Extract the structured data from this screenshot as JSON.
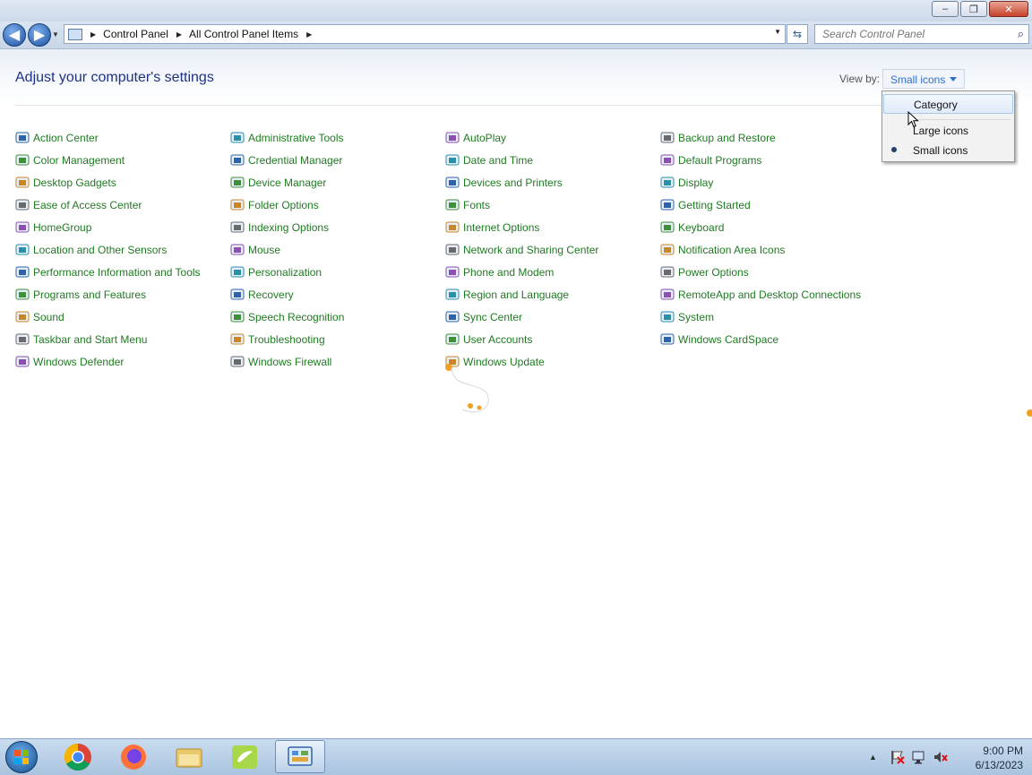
{
  "window": {
    "controls": {
      "minimize": "–",
      "restore": "❐",
      "close": "✕"
    }
  },
  "nav": {
    "back_icon": "arrow-left-icon",
    "forward_icon": "arrow-right-icon",
    "breadcrumb": [
      "Control Panel",
      "All Control Panel Items"
    ],
    "search_placeholder": "Search Control Panel"
  },
  "content": {
    "heading": "Adjust your computer's settings",
    "view_by_label": "View by:",
    "view_by_value": "Small icons",
    "columns": [
      [
        "Action Center",
        "Color Management",
        "Desktop Gadgets",
        "Ease of Access Center",
        "HomeGroup",
        "Location and Other Sensors",
        "Performance Information and Tools",
        "Programs and Features",
        "Sound",
        "Taskbar and Start Menu",
        "Windows Defender"
      ],
      [
        "Administrative Tools",
        "Credential Manager",
        "Device Manager",
        "Folder Options",
        "Indexing Options",
        "Mouse",
        "Personalization",
        "Recovery",
        "Speech Recognition",
        "Troubleshooting",
        "Windows Firewall"
      ],
      [
        "AutoPlay",
        "Date and Time",
        "Devices and Printers",
        "Fonts",
        "Internet Options",
        "Network and Sharing Center",
        "Phone and Modem",
        "Region and Language",
        "Sync Center",
        "User Accounts",
        "Windows Update"
      ],
      [
        "Backup and Restore",
        "Default Programs",
        "Display",
        "Getting Started",
        "Keyboard",
        "Notification Area Icons",
        "Power Options",
        "RemoteApp and Desktop Connections",
        "System",
        "Windows CardSpace"
      ]
    ]
  },
  "view_menu": {
    "items": [
      "Category",
      "Large icons",
      "Small icons"
    ],
    "selected": "Small icons",
    "hovered": "Category"
  },
  "taskbar": {
    "apps": [
      "chrome-icon",
      "firefox-icon",
      "file-explorer-icon",
      "paint-icon",
      "control-panel-icon"
    ],
    "active_app": "control-panel-icon",
    "time": "9:00 PM",
    "date": "6/13/2023"
  },
  "colors": {
    "link_green": "#1f7a22",
    "heading_blue": "#1e3287",
    "accent_blue": "#2d6fd1"
  }
}
